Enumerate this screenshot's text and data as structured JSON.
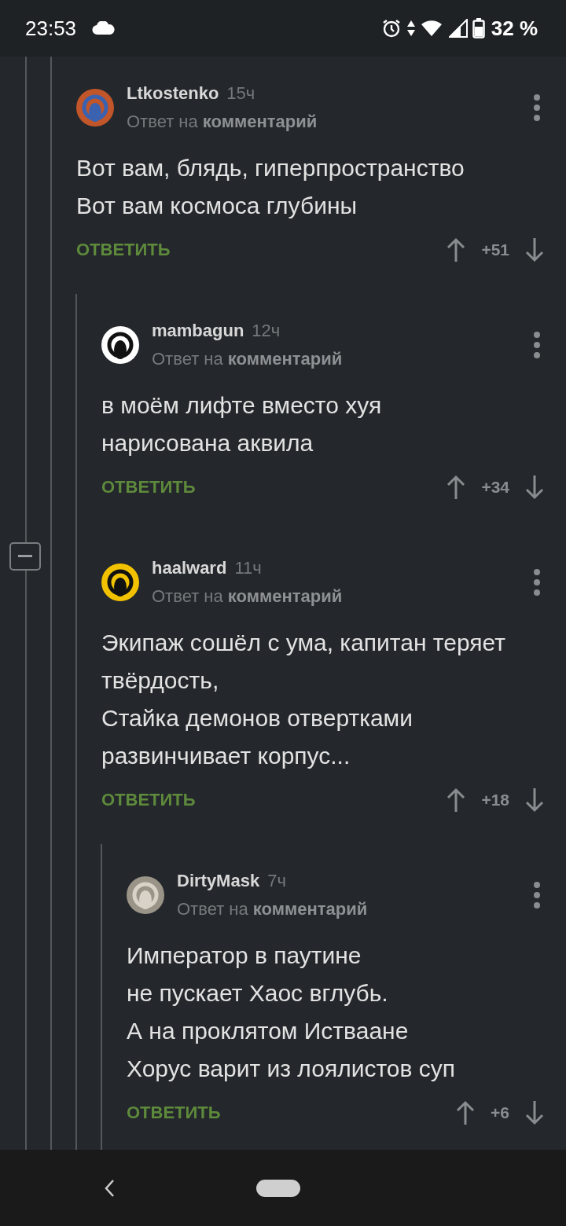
{
  "status_bar": {
    "time": "23:53",
    "battery": "32 %"
  },
  "thread_collapse_shown": true,
  "comments": [
    {
      "author": "Ltkostenko",
      "time": "15ч",
      "reply_to": "Ответ на **комментарий**",
      "lines": [
        "Вот вам, блядь, гиперпространство",
        "Вот вам космоса глубины"
      ],
      "reply": "ОТВЕТИТЬ",
      "score": "+51",
      "children": [
        {
          "author": "mambagun",
          "time": "12ч",
          "reply_to": "Ответ на **комментарий**",
          "lines": [
            "в моём лифте вместо хуя",
            "нарисована аквила"
          ],
          "reply": "ОТВЕТИТЬ",
          "score": "+34"
        },
        {
          "author": "haalward",
          "time": "11ч",
          "reply_to": "Ответ на **комментарий**",
          "lines": [
            "Экипаж сошёл с ума, капитан теряет твёрдость,",
            "Стайка демонов отвертками развинчивает корпус..."
          ],
          "reply": "ОТВЕТИТЬ",
          "score": "+18",
          "children": [
            {
              "author": "DirtyMask",
              "time": "7ч",
              "reply_to": "Ответ на **комментарий**",
              "lines": [
                "Император в паутине",
                "не пускает Хаос вглубь.",
                "А на проклятом Истваане",
                "Хорус варит из лоялистов суп"
              ],
              "reply": "ОТВЕТИТЬ",
              "score": "+6"
            }
          ]
        }
      ]
    }
  ]
}
